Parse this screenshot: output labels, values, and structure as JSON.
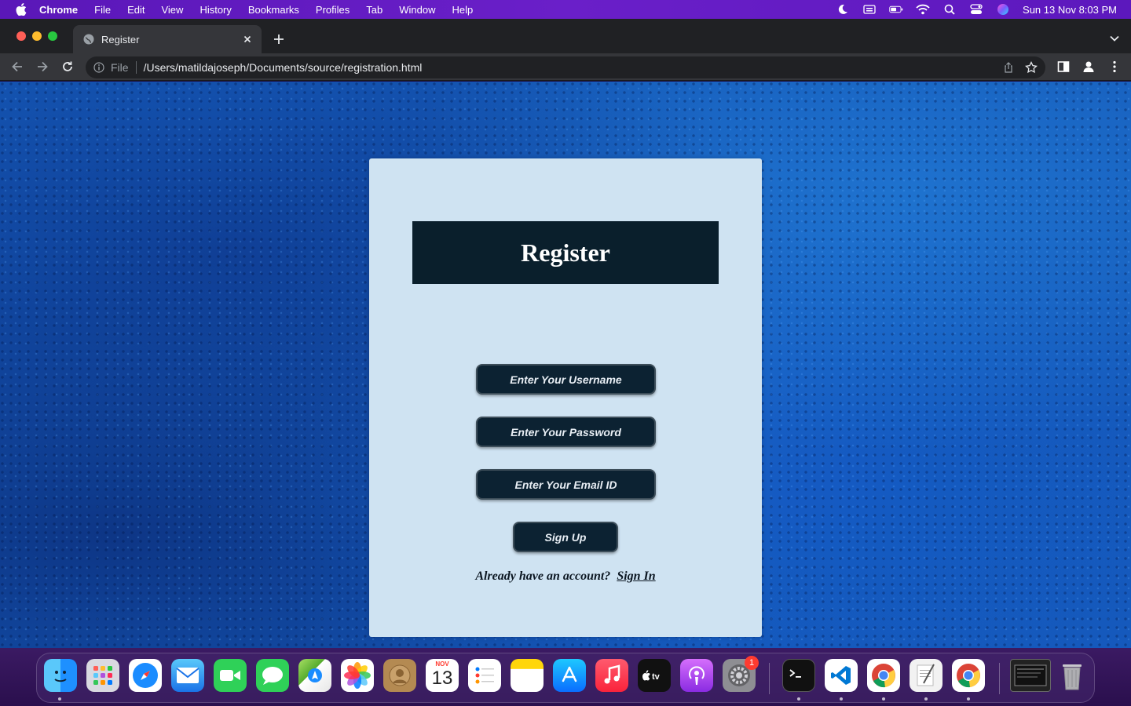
{
  "menubar": {
    "app_name": "Chrome",
    "items": [
      "File",
      "Edit",
      "View",
      "History",
      "Bookmarks",
      "Profiles",
      "Tab",
      "Window",
      "Help"
    ],
    "clock": "Sun 13 Nov  8:03 PM",
    "status_icons": [
      "moon-icon",
      "keyboard-icon",
      "battery-icon",
      "wifi-icon",
      "spotlight-search-icon",
      "control-center-icon",
      "siri-icon"
    ]
  },
  "browser": {
    "tab_title": "Register",
    "url_scheme": "File",
    "url": "/Users/matildajoseph/Documents/source/registration.html"
  },
  "page": {
    "heading": "Register",
    "username_placeholder": "Enter Your Username",
    "password_placeholder": "Enter Your Password",
    "email_placeholder": "Enter Your Email ID",
    "signup_label": "Sign Up",
    "signin_prompt": "Already have an account?",
    "signin_link": "Sign In"
  },
  "dock": {
    "calendar_month": "NOV",
    "calendar_day": "13",
    "settings_badge": "1",
    "apps": [
      "Finder",
      "Launchpad",
      "Safari",
      "Mail",
      "FaceTime",
      "Messages",
      "Maps",
      "Photos",
      "Contacts",
      "Calendar",
      "Reminders",
      "Notes",
      "App Store",
      "Music",
      "TV",
      "Podcasts",
      "System Preferences",
      "Terminal",
      "Visual Studio Code",
      "Google Chrome",
      "TextEdit",
      "Google Chrome",
      "Screen",
      "Trash"
    ]
  },
  "colors": {
    "menubar": "#5a17b8",
    "page_background": "#1559b8",
    "card_background": "#cfe3f2",
    "header_background": "#0a1f2c",
    "field_background": "#0c2232"
  }
}
